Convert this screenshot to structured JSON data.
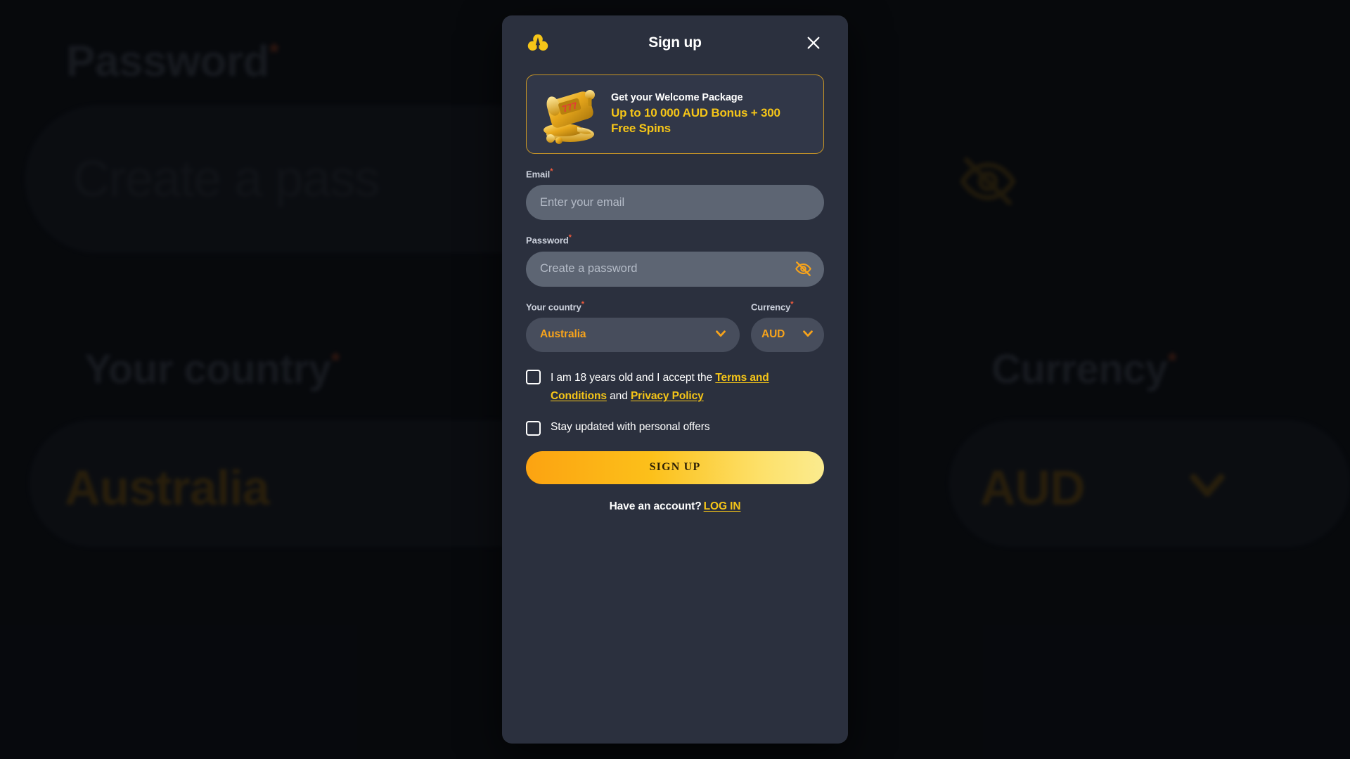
{
  "background": {
    "password_label": "Password",
    "password_placeholder": "Create a pass",
    "country_label": "Your country",
    "country_value": "Australia",
    "currency_label": "Currency",
    "currency_value": "AUD",
    "required_marker": "*"
  },
  "modal": {
    "title": "Sign up",
    "logo_icon": "club-logo-icon",
    "close_icon": "close-icon",
    "promo": {
      "art_icon": "slot-machine-coins-icon",
      "reel_digits": "777",
      "title": "Get your Welcome Package",
      "offer": "Up to 10 000 AUD Bonus + 300 Free Spins"
    },
    "fields": {
      "required_marker": "*",
      "email": {
        "label": "Email",
        "placeholder": "Enter your email",
        "value": ""
      },
      "password": {
        "label": "Password",
        "placeholder": "Create a password",
        "value": "",
        "toggle_icon": "eye-off-icon"
      },
      "country": {
        "label": "Your country",
        "value": "Australia",
        "chevron_icon": "chevron-down-icon"
      },
      "currency": {
        "label": "Currency",
        "value": "AUD",
        "chevron_icon": "chevron-down-icon"
      }
    },
    "consent": {
      "age_terms_prefix": "I am 18 years old and I accept the",
      "terms_link": "Terms and Conditions",
      "and_word": "and",
      "privacy_link": "Privacy Policy",
      "offers_label": "Stay updated with personal offers"
    },
    "submit_label": "SIGN UP",
    "footer": {
      "prompt": "Have an account?",
      "login_link": "LOG IN"
    }
  },
  "colors": {
    "modal_bg": "#2b303e",
    "accent_yellow": "#f5c518",
    "accent_orange": "#f7a31b",
    "required_red": "#f05a3c",
    "input_bg": "#5d6573",
    "select_bg": "#474d5c",
    "promo_border": "#c79526"
  }
}
